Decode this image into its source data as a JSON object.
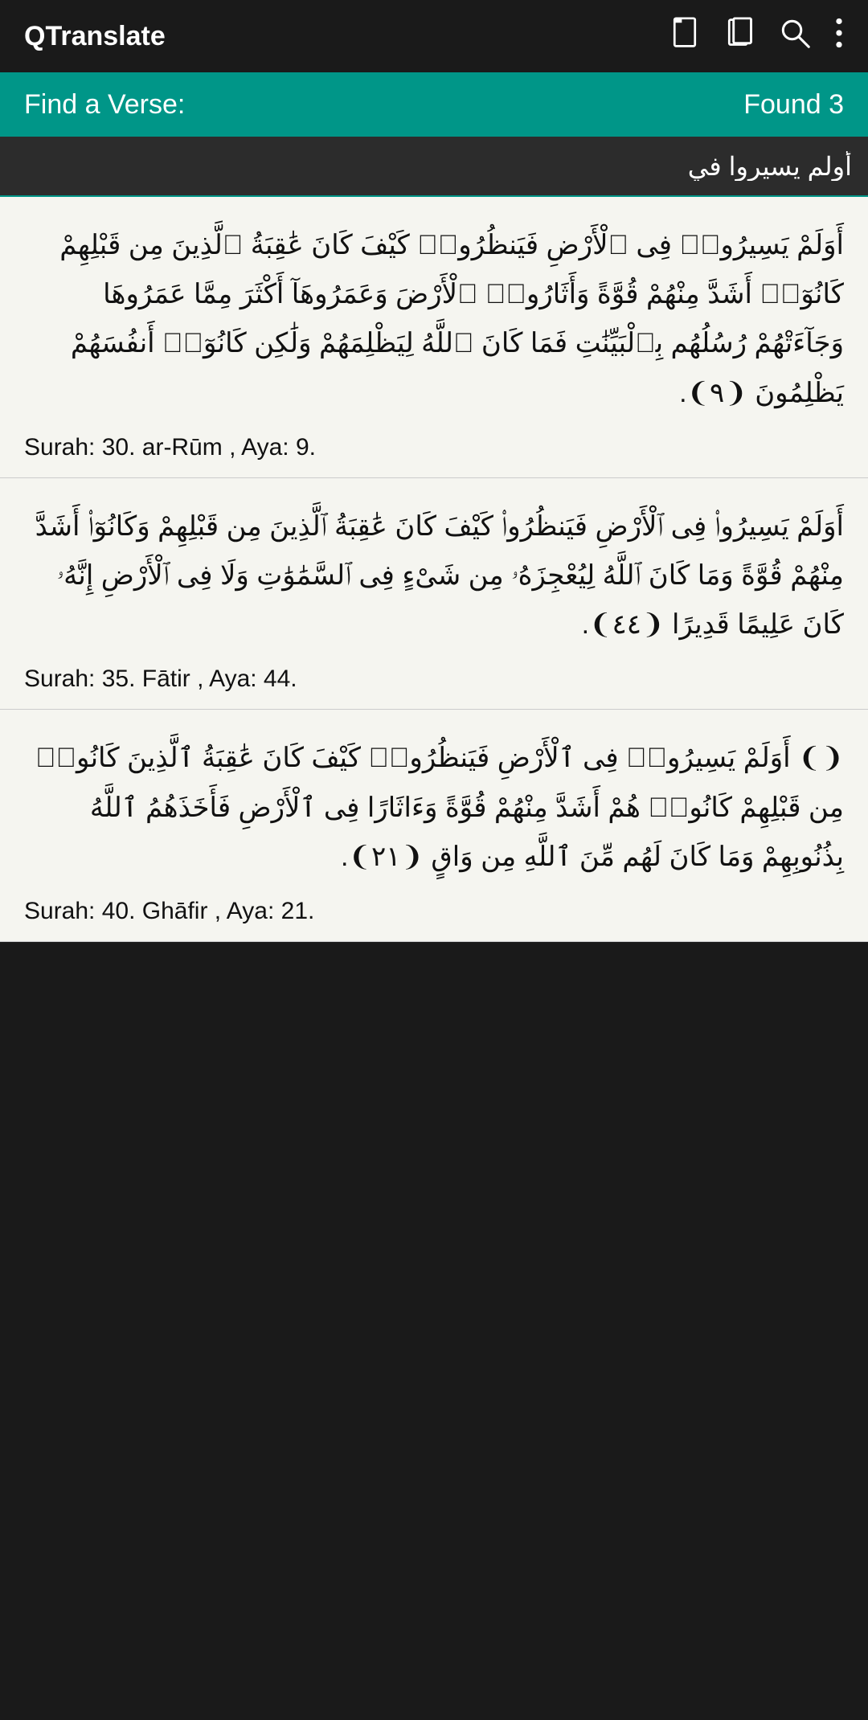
{
  "appBar": {
    "title": "QTranslate",
    "icons": [
      "bookmark-outline",
      "bookmarks-outline",
      "search",
      "more-vertical"
    ]
  },
  "findBar": {
    "label": "Find a Verse:",
    "foundCount": "Found 3"
  },
  "searchBar": {
    "inputValue": "أولم يسيروا في",
    "placeholder": ""
  },
  "verses": [
    {
      "id": "verse-1",
      "arabicText": "أَوَلَمْ يَسِيرُوا۟ فِى ٱلْأَرْضِ فَيَنظُرُوا۟ كَيْفَ كَانَ عَٰقِبَةُ ٱلَّذِينَ مِن قَبْلِهِمْ كَانُوٓا۟ أَشَدَّ مِنْهُمْ قُوَّةً وَأَثَارُوا۟ ٱلْأَرْضَ وَعَمَرُوهَآ أَكْثَرَ مِمَّا عَمَرُوهَا وَجَآءَتْهُمْ رُسُلُهُم بِٱلْبَيِّنَٰتِ فَمَا كَانَ ٱللَّهُ لِيَظْلِمَهُمْ وَلَٰكِن كَانُوٓا۟ أَنفُسَهُمْ يَظْلِمُونَ ❨٩❩.",
      "reference": "Surah: 30. ar-Rūm , Aya: 9."
    },
    {
      "id": "verse-2",
      "arabicText": "أَوَلَمْ يَسِيرُوا۟ فِى ٱلْأَرْضِ فَيَنظُرُوا۟ كَيْفَ كَانَ عَٰقِبَةُ ٱلَّذِينَ مِن قَبْلِهِمْ وَكَانُوٓا۟ أَشَدَّ مِنْهُمْ قُوَّةً وَمَا كَانَ ٱللَّهُ لِيُعْجِزَهُۥ مِن شَىْءٍ فِى ٱلسَّمَٰوَٰتِ وَلَا فِى ٱلْأَرْضِ إِنَّهُۥ كَانَ عَلِيمًا قَدِيرًا ❨٤٤❩.",
      "reference": "Surah: 35. Fātir , Aya: 44."
    },
    {
      "id": "verse-3",
      "arabicText": "❨❩ أَوَلَمْ يَسِيرُوا۟ فِى ٱلْأَرْضِ فَيَنظُرُوا۟ كَيْفَ كَانَ عَٰقِبَةُ ٱلَّذِينَ كَانُوا۟ مِن قَبْلِهِمْ كَانُوا۟ هُمْ أَشَدَّ مِنْهُمْ قُوَّةً وَءَاثَارًا فِى ٱلْأَرْضِ فَأَخَذَهُمُ ٱللَّهُ بِذُنُوبِهِمْ وَمَا كَانَ لَهُم مِّنَ ٱللَّهِ مِن وَاقٍ ❨٢١❩.",
      "reference": "Surah: 40. Ghāfir , Aya: 21."
    }
  ]
}
